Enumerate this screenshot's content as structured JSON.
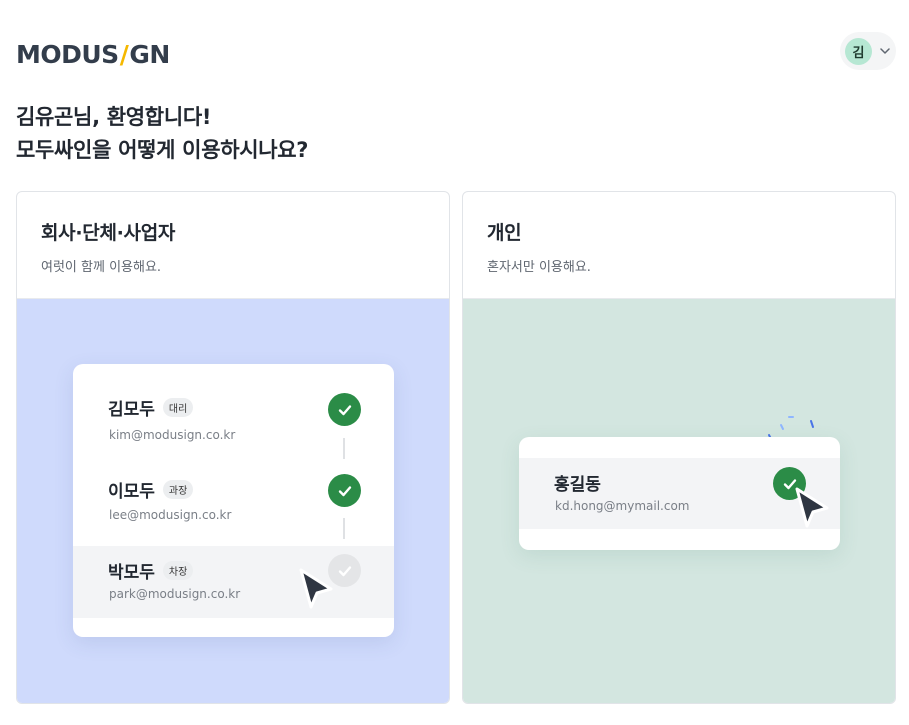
{
  "header": {
    "logo": {
      "part1": "MODUS",
      "slash": "/",
      "part2": "GN"
    },
    "user": {
      "avatar_text": "김"
    }
  },
  "greeting": {
    "line1": "김유곤님, 환영합니다!",
    "line2": "모두싸인을 어떻게 이용하시나요?"
  },
  "cards": {
    "company": {
      "title": "회사·단체·사업자",
      "description": "여럿이 함께 이용해요.",
      "signers": [
        {
          "name": "김모두",
          "role": "대리",
          "email": "kim@modusign.co.kr",
          "status": "done"
        },
        {
          "name": "이모두",
          "role": "과장",
          "email": "lee@modusign.co.kr",
          "status": "done"
        },
        {
          "name": "박모두",
          "role": "차장",
          "email": "park@modusign.co.kr",
          "status": "pending"
        }
      ]
    },
    "personal": {
      "title": "개인",
      "description": "혼자서만 이용해요.",
      "signer": {
        "name": "홍길동",
        "email": "kd.hong@mymail.com",
        "status": "done"
      }
    }
  },
  "colors": {
    "company_bg": "#cfdafc",
    "personal_bg": "#d3e6e0",
    "check_green": "#2b8c47",
    "logo_slash": "#f5b800",
    "avatar_bg": "#b6e7d3"
  }
}
